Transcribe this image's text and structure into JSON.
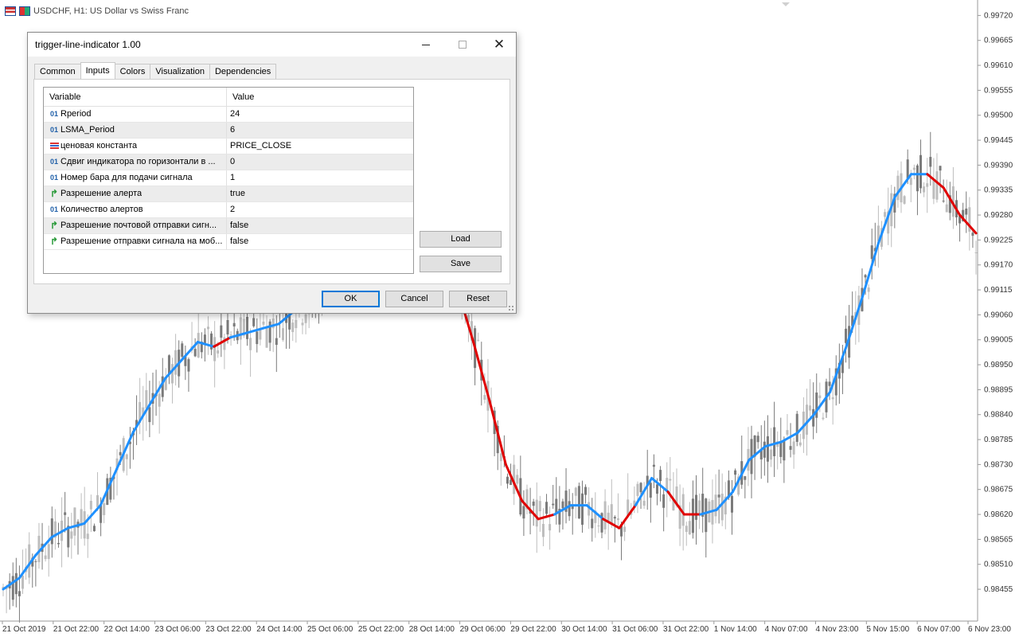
{
  "chart_header": {
    "symbol_text": "USDCHF, H1:  US Dollar vs Swiss Franc"
  },
  "price_axis": {
    "labels": [
      "0.99720",
      "0.99665",
      "0.99610",
      "0.99555",
      "0.99500",
      "0.99445",
      "0.99390",
      "0.99335",
      "0.99280",
      "0.99225",
      "0.99170",
      "0.99115",
      "0.99060",
      "0.99005",
      "0.98950",
      "0.98895",
      "0.98840",
      "0.98785",
      "0.98730",
      "0.98675",
      "0.98620",
      "0.98565",
      "0.98510",
      "0.98455"
    ]
  },
  "time_axis": {
    "labels": [
      "21 Oct 2019",
      "21 Oct 22:00",
      "22 Oct 14:00",
      "23 Oct 06:00",
      "23 Oct 22:00",
      "24 Oct 14:00",
      "25 Oct 06:00",
      "25 Oct 22:00",
      "28 Oct 14:00",
      "29 Oct 06:00",
      "29 Oct 22:00",
      "30 Oct 14:00",
      "31 Oct 06:00",
      "31 Oct 22:00",
      "1 Nov 14:00",
      "4 Nov 07:00",
      "4 Nov 23:00",
      "5 Nov 15:00",
      "6 Nov 07:00",
      "6 Nov 23:00"
    ]
  },
  "chart_data": {
    "type": "line",
    "xlabel": "",
    "ylabel": "",
    "ylim": [
      0.9842,
      0.9974
    ],
    "series": [
      {
        "color_up": "#1e90ff",
        "color_down": "#e00000",
        "x": [
          0,
          1,
          2,
          3,
          4,
          5,
          6,
          7,
          8,
          9,
          10,
          11,
          12,
          13,
          14,
          15,
          16,
          17,
          18,
          19,
          20,
          21,
          22,
          23,
          24,
          25,
          26,
          27,
          28,
          29,
          30,
          31,
          32,
          33,
          34,
          35,
          36,
          37,
          38,
          39,
          40,
          41,
          42,
          43,
          44,
          45,
          46,
          47,
          48,
          49,
          50,
          51,
          52,
          53,
          54,
          55,
          56,
          57,
          58,
          59,
          60
        ],
        "values": [
          0.98455,
          0.9848,
          0.9853,
          0.9857,
          0.9859,
          0.986,
          0.9864,
          0.9872,
          0.988,
          0.9886,
          0.9892,
          0.9896,
          0.99,
          0.9899,
          0.9901,
          0.9902,
          0.9903,
          0.9904,
          0.9907,
          0.9908,
          0.9912,
          0.992,
          0.9929,
          0.9934,
          0.9938,
          0.9938,
          0.9929,
          0.9923,
          0.9912,
          0.99,
          0.9887,
          0.9873,
          0.9865,
          0.9861,
          0.9862,
          0.9864,
          0.9864,
          0.9861,
          0.9859,
          0.9864,
          0.987,
          0.9867,
          0.9862,
          0.9862,
          0.9863,
          0.9867,
          0.9874,
          0.9877,
          0.9878,
          0.988,
          0.9884,
          0.9889,
          0.9899,
          0.991,
          0.9922,
          0.9932,
          0.9937,
          0.9937,
          0.9934,
          0.9928,
          0.9924
        ],
        "trend": [
          "up",
          "up",
          "up",
          "up",
          "up",
          "up",
          "up",
          "up",
          "up",
          "up",
          "up",
          "up",
          "up",
          "down",
          "up",
          "up",
          "up",
          "up",
          "up",
          "up",
          "up",
          "up",
          "up",
          "up",
          "up",
          "down",
          "down",
          "down",
          "down",
          "down",
          "down",
          "down",
          "down",
          "down",
          "up",
          "up",
          "up",
          "down",
          "down",
          "up",
          "up",
          "down",
          "down",
          "up",
          "up",
          "up",
          "up",
          "up",
          "up",
          "up",
          "up",
          "up",
          "up",
          "up",
          "up",
          "up",
          "up",
          "down",
          "down",
          "down",
          "down"
        ]
      }
    ]
  },
  "dialog": {
    "title": "trigger-line-indicator 1.00",
    "tabs": [
      {
        "label": "Common"
      },
      {
        "label": "Inputs"
      },
      {
        "label": "Colors"
      },
      {
        "label": "Visualization"
      },
      {
        "label": "Dependencies"
      }
    ],
    "grid_header": {
      "variable": "Variable",
      "value": "Value"
    },
    "rows": [
      {
        "type": "int",
        "type_label": "01",
        "variable": "Rperiod",
        "value": "24"
      },
      {
        "type": "int",
        "type_label": "01",
        "variable": "LSMA_Period",
        "value": "6"
      },
      {
        "type": "enum",
        "type_label": "",
        "variable": "ценовая константа",
        "value": "PRICE_CLOSE"
      },
      {
        "type": "int",
        "type_label": "01",
        "variable": "Сдвиг индикатора по горизонтали в ...",
        "value": "0"
      },
      {
        "type": "int",
        "type_label": "01",
        "variable": "Номер бара для подачи сигнала",
        "value": "1"
      },
      {
        "type": "bool",
        "type_label": "↱",
        "variable": "Разрешение алерта",
        "value": "true"
      },
      {
        "type": "int",
        "type_label": "01",
        "variable": "Количество алертов",
        "value": "2"
      },
      {
        "type": "bool",
        "type_label": "↱",
        "variable": "Разрешение почтовой отправки сигн...",
        "value": "false"
      },
      {
        "type": "bool",
        "type_label": "↱",
        "variable": "Разрешение отправки сигнала на моб...",
        "value": "false"
      }
    ],
    "load_label": "Load",
    "save_label": "Save",
    "ok_label": "OK",
    "cancel_label": "Cancel",
    "reset_label": "Reset"
  }
}
